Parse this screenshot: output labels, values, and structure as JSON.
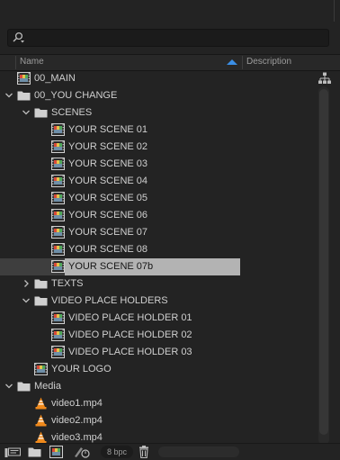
{
  "panel": {
    "search": {
      "value": "",
      "placeholder": ""
    },
    "columns": {
      "name": "Name",
      "description": "Description"
    }
  },
  "tree": {
    "root_comp": "00_MAIN",
    "you_change": "00_YOU CHANGE",
    "scenes_folder": "SCENES",
    "scenes": [
      "YOUR SCENE 01",
      "YOUR SCENE 02",
      "YOUR SCENE 03",
      "YOUR SCENE 04",
      "YOUR SCENE 05",
      "YOUR SCENE 06",
      "YOUR SCENE 07",
      "YOUR SCENE 08",
      "YOUR SCENE 07b"
    ],
    "texts_folder": "TEXTS",
    "video_folder": "VIDEO PLACE HOLDERS",
    "video_holders": [
      "VIDEO PLACE HOLDER 01",
      "VIDEO PLACE HOLDER 02",
      "VIDEO PLACE HOLDER 03"
    ],
    "logo_comp": "YOUR LOGO",
    "media_folder": "Media",
    "media": [
      "video1.mp4",
      "video2.mp4",
      "video3.mp4"
    ],
    "selected_item": "YOUR SCENE 07b"
  },
  "footer": {
    "bpc_label": "8 bpc"
  },
  "colors": {
    "accent": "#3b8fe6",
    "background": "#232323",
    "selection": "#b3b3b3",
    "folder": "#cfcfcf",
    "vlc_orange": "#f08a1c"
  },
  "icons": [
    "search-icon",
    "flowchart-icon",
    "sort-ascending-icon",
    "composition-icon",
    "folder-icon",
    "chevron-down-icon",
    "chevron-right-icon",
    "vlc-icon",
    "interpret-footage-icon",
    "new-folder-icon",
    "new-composition-icon",
    "project-settings-icon",
    "trash-icon"
  ]
}
